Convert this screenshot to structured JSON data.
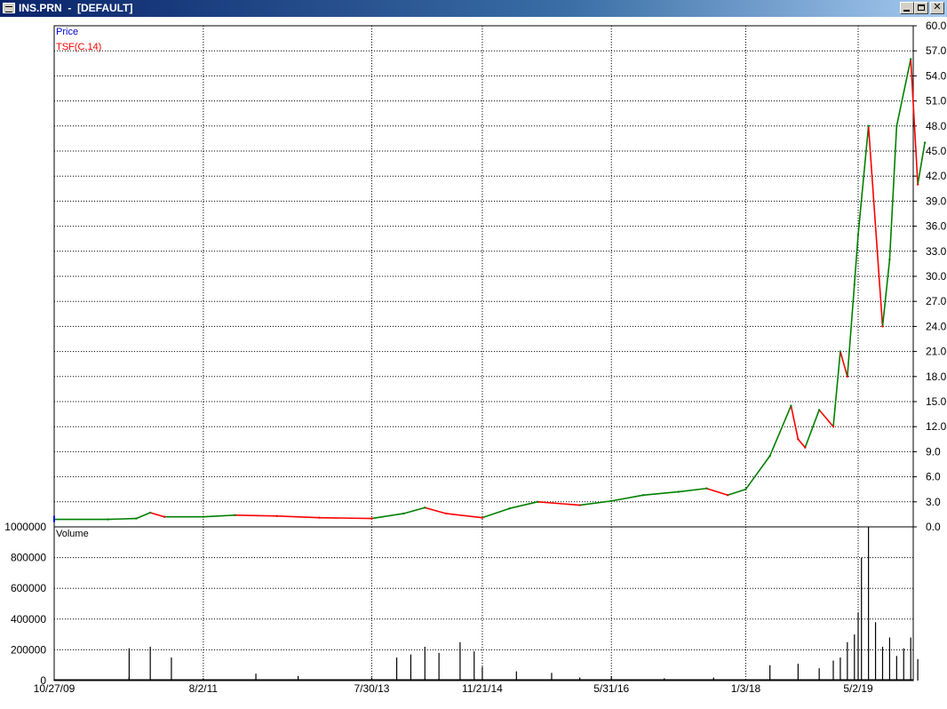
{
  "window": {
    "title": "INS.PRN  -  [DEFAULT]",
    "buttons": {
      "minimize": "minimize-icon",
      "maximize": "maximize-icon",
      "close": "close-icon"
    }
  },
  "colors": {
    "price_line": "#0000ff",
    "tsf_up": "#008000",
    "tsf_down": "#ff0000",
    "volume": "#000000",
    "grid": "#000000"
  },
  "chart_data": [
    {
      "type": "line",
      "title": "",
      "legend_position": "top-left",
      "legend": [
        "Price",
        "TSF(C,14)"
      ],
      "legend_colors": [
        "#0000cc",
        "#ff0000"
      ],
      "ylabel": "",
      "ylim": [
        0,
        60
      ],
      "y_ticks": [
        "60.0",
        "57.0",
        "54.0",
        "51.0",
        "48.0",
        "45.0",
        "42.0",
        "39.0",
        "36.0",
        "33.0",
        "30.0",
        "27.0",
        "24.0",
        "21.0",
        "18.0",
        "15.0",
        "12.0",
        "9.0",
        "6.0",
        "3.0",
        "0.0"
      ],
      "x_ticks": [
        "10/27/09",
        "8/2/11",
        "7/30/13",
        "11/21/14",
        "5/31/16",
        "1/3/18",
        "5/2/19"
      ],
      "grid": true,
      "series": [
        {
          "name": "TSF(C,14)",
          "x": [
            "10/27/09",
            "2010-06",
            "2010-10",
            "2010-12",
            "2011-02",
            "8/2/11",
            "2011-12",
            "2012-06",
            "2012-12",
            "7/30/13",
            "2013-12",
            "2014-03",
            "2014-06",
            "11/21/14",
            "2015-03",
            "2015-07",
            "2016-01",
            "5/31/16",
            "2016-10",
            "2017-03",
            "2017-07",
            "2017-10",
            "1/3/18",
            "2018-04",
            "2018-07",
            "2018-08",
            "2018-09",
            "2018-11",
            "2019-01",
            "2019-02",
            "2019-03",
            "2019-04",
            "5/2/19",
            "2019-06",
            "2019-08",
            "2019-09",
            "2019-10",
            "2019-12",
            "2020-01",
            "2020-02"
          ],
          "values": [
            0.9,
            0.9,
            1.0,
            1.7,
            1.2,
            1.2,
            1.4,
            1.3,
            1.1,
            1.0,
            1.6,
            2.3,
            1.6,
            1.1,
            2.2,
            3.0,
            2.6,
            3.1,
            3.8,
            4.2,
            4.6,
            3.8,
            4.5,
            8.5,
            14.5,
            10.5,
            9.5,
            14.0,
            12.0,
            21.0,
            18.0,
            29.0,
            35.0,
            48.0,
            24.0,
            32.0,
            48.0,
            56.0,
            41.0,
            46.0
          ]
        }
      ]
    },
    {
      "type": "bar",
      "title": "",
      "legend": [
        "Volume"
      ],
      "ylim": [
        0,
        1000000
      ],
      "y_ticks": [
        "1000000",
        "800000",
        "600000",
        "400000",
        "200000",
        "0"
      ],
      "grid": true,
      "series": [
        {
          "name": "Volume",
          "x": [
            "10/27/09",
            "2010-09",
            "2010-09",
            "2010-12",
            "2011-03",
            "8/2/11",
            "2012-03",
            "2012-09",
            "7/30/13",
            "2013-11",
            "2014-01",
            "2014-03",
            "2014-05",
            "2014-08",
            "2014-10",
            "11/21/14",
            "2015-04",
            "2015-09",
            "2016-01",
            "5/31/16",
            "2017-01",
            "2017-08",
            "1/3/18",
            "2018-04",
            "2018-08",
            "2018-11",
            "2019-01",
            "2019-02",
            "2019-03",
            "2019-04",
            "5/2/19",
            "2019-05",
            "2019-06",
            "2019-07",
            "2019-08",
            "2019-09",
            "2019-10",
            "2019-11",
            "2019-12",
            "2020-01"
          ],
          "values": [
            10000,
            25000,
            210000,
            220000,
            150000,
            15000,
            45000,
            30000,
            20000,
            150000,
            170000,
            220000,
            180000,
            250000,
            190000,
            90000,
            60000,
            50000,
            20000,
            30000,
            15000,
            20000,
            10000,
            100000,
            110000,
            80000,
            130000,
            150000,
            250000,
            300000,
            440000,
            800000,
            1000000,
            380000,
            220000,
            280000,
            160000,
            210000,
            280000,
            140000
          ]
        }
      ]
    }
  ]
}
